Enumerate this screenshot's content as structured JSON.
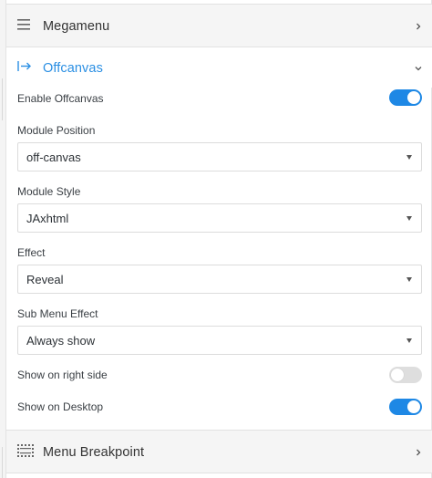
{
  "colors": {
    "accent": "#2b8fe3",
    "toggle_on": "#1e88e5",
    "toggle_off": "#dedede"
  },
  "megamenu": {
    "title": "Megamenu",
    "icon": "hamburger-icon",
    "chevron": "chevron-right-icon"
  },
  "offcanvas": {
    "title": "Offcanvas",
    "icon": "arrow-to-right-icon",
    "chevron": "chevron-down-icon",
    "enable": {
      "label": "Enable Offcanvas",
      "on": true
    },
    "module_position": {
      "label": "Module Position",
      "value": "off-canvas"
    },
    "module_style": {
      "label": "Module Style",
      "value": "JAxhtml"
    },
    "effect": {
      "label": "Effect",
      "value": "Reveal"
    },
    "sub_menu_effect": {
      "label": "Sub Menu Effect",
      "value": "Always show"
    },
    "right_side": {
      "label": "Show on right side",
      "on": false
    },
    "desktop": {
      "label": "Show on Desktop",
      "on": true
    }
  },
  "breakpoint": {
    "title": "Menu Breakpoint",
    "icon": "breakpoint-grid-icon",
    "chevron": "chevron-right-icon"
  }
}
